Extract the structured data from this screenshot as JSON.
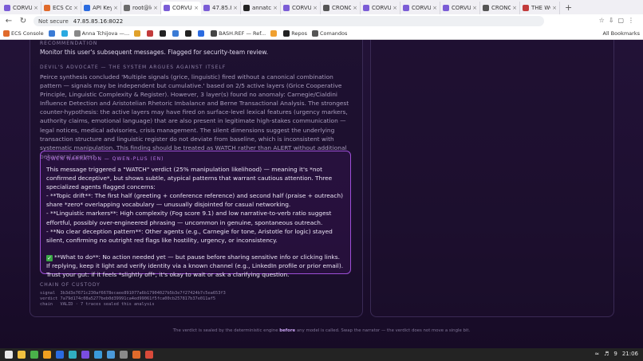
{
  "browser": {
    "tabs": [
      {
        "label": "CORVU",
        "color": "#7b5cd6"
      },
      {
        "label": "ECS Co",
        "color": "#e06a2b"
      },
      {
        "label": "API Keys",
        "color": "#2b6be0"
      },
      {
        "label": "root@lo",
        "color": "#6b6b6b"
      },
      {
        "label": "CORVU",
        "color": "#7b5cd6",
        "active": true
      },
      {
        "label": "47.85.8",
        "color": "#7b5cd6"
      },
      {
        "label": "annatch",
        "color": "#222222"
      },
      {
        "label": "CORVU",
        "color": "#7b5cd6"
      },
      {
        "label": "CRONO",
        "color": "#555555"
      },
      {
        "label": "CORVU",
        "color": "#7b5cd6"
      },
      {
        "label": "CORVU",
        "color": "#7b5cd6"
      },
      {
        "label": "CORVU",
        "color": "#7b5cd6"
      },
      {
        "label": "CRONO",
        "color": "#555555"
      },
      {
        "label": "THE WO",
        "color": "#c23b3b"
      }
    ],
    "new_tab": "+",
    "security": "Not secure",
    "url": "47.85.85.16:8022",
    "bookmarks": [
      {
        "label": "ECS Console",
        "color": "#e06a2b"
      },
      {
        "label": "",
        "color": "#3a7bd5"
      },
      {
        "label": "",
        "color": "#2aa9e0"
      },
      {
        "label": "Anna Tchijova —...",
        "color": "#888888"
      },
      {
        "label": "",
        "color": "#e0a12b"
      },
      {
        "label": "",
        "color": "#c23b3b"
      },
      {
        "label": "",
        "color": "#222222"
      },
      {
        "label": "",
        "color": "#3a7bd5"
      },
      {
        "label": "",
        "color": "#222222"
      },
      {
        "label": "",
        "color": "#2b6be0"
      },
      {
        "label": "BASH.REF — Ref...",
        "color": "#444444"
      },
      {
        "label": "",
        "color": "#f0a030"
      },
      {
        "label": "Repos",
        "color": "#222222"
      },
      {
        "label": "Comandos",
        "color": "#555555"
      }
    ],
    "all_bookmarks": "All Bookmarks"
  },
  "report": {
    "recommendation_label": "RECOMMENDATION",
    "recommendation_text": "Monitor this user's subsequent messages. Flagged for security-team review.",
    "devils_label": "DEVIL'S ADVOCATE — THE SYSTEM ARGUES AGAINST ITSELF",
    "devils_text": "Peirce synthesis concluded 'Multiple signals (grice, linguistic) fired without a canonical combination pattern — signals may be independent but cumulative.' based on 2/5 active layers (Grice Cooperative Principle, Linguistic Complexity & Register). However, 3 layer(s) found no anomaly: Carnegie/Cialdini Influence Detection and Aristotelian Rhetoric Imbalance and Berne Transactional Analysis. The strongest counter-hypothesis: the active layers may have fired on surface-level lexical features (urgency markers, authority claims, emotional language) that are also present in legitimate high-stakes communication — legal notices, medical advisories, crisis management. The silent dimensions suggest the underlying transaction structure and linguistic register do not deviate from baseline, which is inconsistent with systematic manipulation. This finding should be treated as WATCH rather than ALERT without additional behavioral context.",
    "qwen_label": "QWEN NARRATION — QWEN-PLUS (EN)",
    "qwen_intro": "This message triggered a \"WATCH\" verdict (25% manipulation likelihood) — meaning it's *not confirmed deceptive*, but shows subtle, atypical patterns that warrant cautious attention. Three specialized agents flagged concerns:",
    "qwen_b1": "- **Topic drift**: The first half (greeting + conference reference) and second half (praise + outreach) share *zero* overlapping vocabulary — unusually disjointed for casual networking.",
    "qwen_b2": "- **Linguistic markers**: High complexity (Fog score 9.1) and low narrative-to-verb ratio suggest effortful, possibly over-engineered phrasing — uncommon in genuine, spontaneous outreach.",
    "qwen_b3": "- **No clear deception pattern**: Other agents (e.g., Carnegie for tone, Aristotle for logic) stayed silent, confirming no outright red flags like hostility, urgency, or inconsistency.",
    "qwen_todo": "**What to do**: No action needed yet — but pause before sharing sensitive info or clicking links. If replying, keep it light and verify identity via a known channel (e.g., LinkedIn profile or prior email). Trust your gut: if it feels *slightly off*, it's okay to wait or ask a clarifying question.",
    "chain_label": "CHAIN OF CUSTODY",
    "chain_signal": "signal  3b3d3e7671c230af6678ecaee891077a6b17904027b5b3e7f27424b7c5ea653f3",
    "chain_verdict": "verdict 7a79d174c08a5277beb0d39991ca4ed99061f5fca00cb257817b37e011af5",
    "chain_chain": "chain   VALID · 7 traces sealed this analysis"
  },
  "footer": {
    "pre": "The verdict is sealed by the deterministic engine ",
    "bold": "before",
    "post": " any model is called. Swap the narrator — the verdict does not move a single bit."
  },
  "taskbar": {
    "apps": [
      "#e8e8e8",
      "#f0c040",
      "#4ab04a",
      "#f0a020",
      "#2b6be0",
      "#30b0c0",
      "#7a4de0",
      "#3a9ad9",
      "#4a9ad9",
      "#8a8a8a",
      "#e06a2b",
      "#d94a3a"
    ],
    "time": "21:06",
    "battery": "9"
  }
}
